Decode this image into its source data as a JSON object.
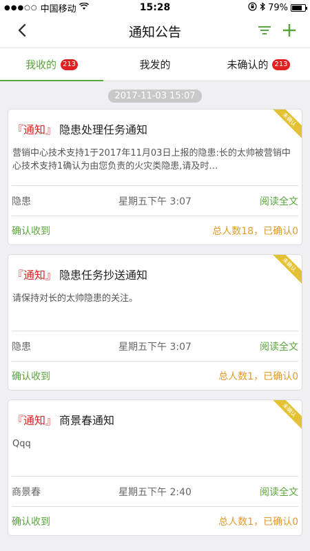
{
  "status_bar": {
    "signal": "●●●○○",
    "carrier": "中国移动",
    "wifi_icon": "wifi-icon",
    "time": "15:28",
    "battery": "79%",
    "battery_level": 0.79
  },
  "nav": {
    "title": "通知公告",
    "back_icon": "chevron-left-icon",
    "filter_icon": "filter-icon",
    "add_icon": "plus-icon",
    "accent": "#5aa53d"
  },
  "tabs": [
    {
      "label": "我收的",
      "badge": "213",
      "active": true
    },
    {
      "label": "我发的",
      "badge": "",
      "active": false
    },
    {
      "label": "未确认的",
      "badge": "213",
      "active": false
    }
  ],
  "date_chip": "2017-11-03 15:07",
  "cards": [
    {
      "tag": "『通知』",
      "title": "隐患处理任务通知",
      "desc": "营销中心技术支持1于2017年11月03日上报的隐患:长的太帅被营销中心技术支持1确认为由您负责的火灾类隐患,请及时…",
      "category": "隐患",
      "time": "星期五下午 3:07",
      "read_label": "阅读全文",
      "confirm_label": "确认收到",
      "stats": "总人数18，已确认0",
      "ribbon": "未确认"
    },
    {
      "tag": "『通知』",
      "title": "隐患任务抄送通知",
      "desc": "请保持对长的太帅隐患的关注。",
      "category": "隐患",
      "time": "星期五下午 3:07",
      "read_label": "阅读全文",
      "confirm_label": "确认收到",
      "stats": "总人数1，已确认0",
      "ribbon": "未确认"
    },
    {
      "tag": "『通知』",
      "title": "商景春通知",
      "desc": "Qqq",
      "category": "商景春",
      "time": "星期五下午 2:40",
      "read_label": "阅读全文",
      "confirm_label": "确认收到",
      "stats": "总人数1，已确认0",
      "ribbon": "未确认"
    }
  ]
}
